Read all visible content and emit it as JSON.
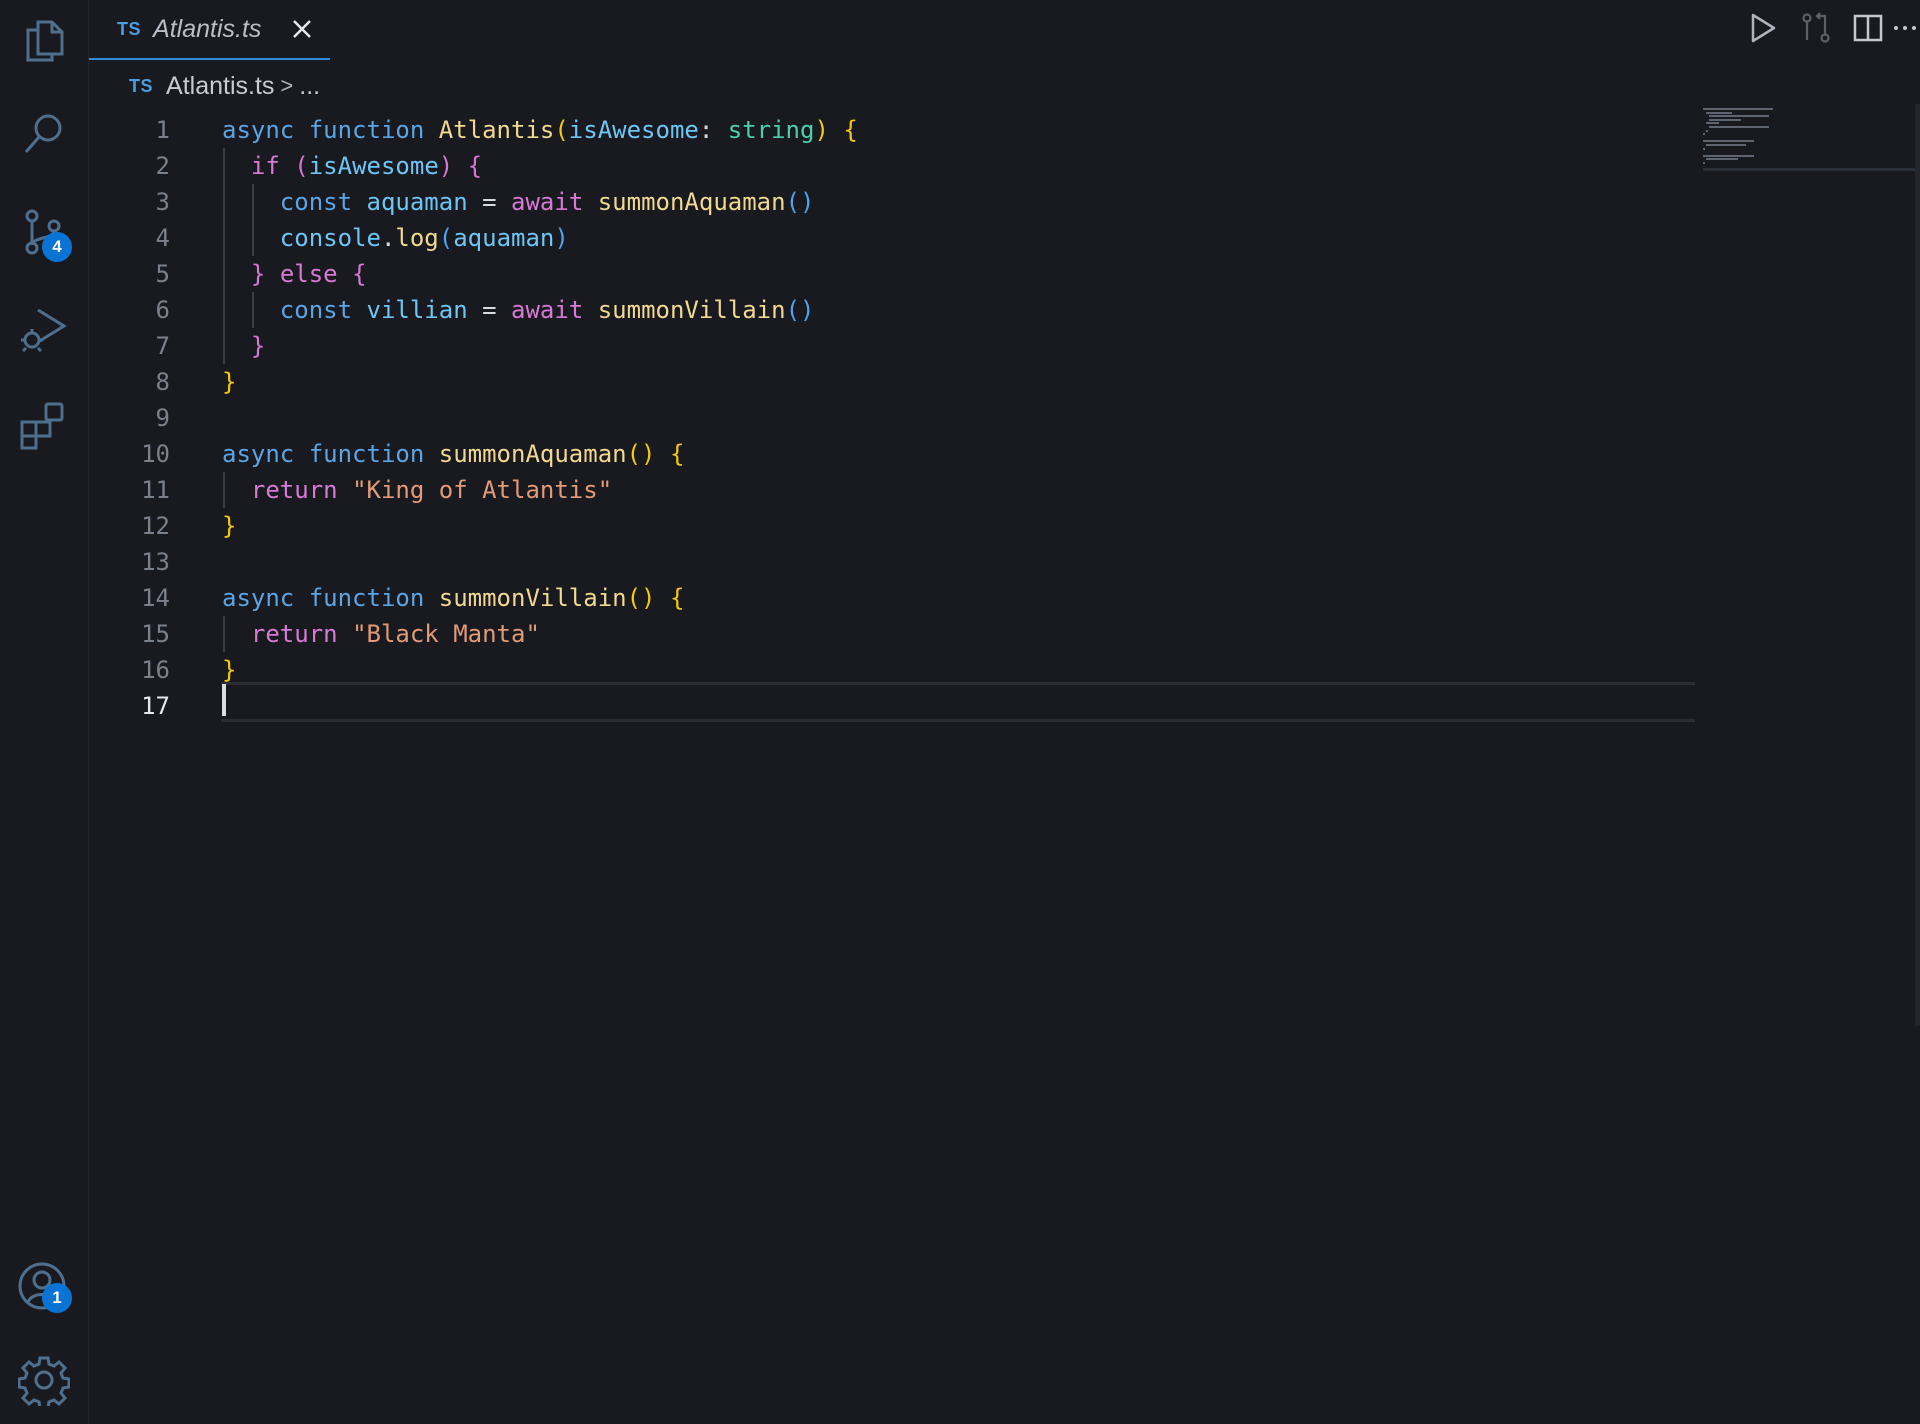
{
  "tab": {
    "lang_badge": "TS",
    "filename": "Atlantis.ts"
  },
  "breadcrumb": {
    "lang_badge": "TS",
    "file": "Atlantis.ts",
    "separator": ">",
    "ellipsis": "..."
  },
  "activity_bar": {
    "items": [
      "explorer-icon",
      "search-icon",
      "source-control-icon",
      "run-debug-icon",
      "extensions-icon"
    ],
    "source_control_badge": "4",
    "accounts_badge": "1",
    "bottom_items": [
      "accounts-icon",
      "settings-gear-icon"
    ]
  },
  "toolbar": {
    "items": [
      "run-icon",
      "compare-changes-icon",
      "split-editor-icon",
      "more-actions-icon"
    ]
  },
  "editor": {
    "active_line": 17,
    "lines": [
      {
        "n": "1",
        "tokens": [
          [
            "kw",
            "async "
          ],
          [
            "kw",
            "function "
          ],
          [
            "fn",
            "Atlantis"
          ],
          [
            "br1",
            "("
          ],
          [
            "var",
            "isAwesome"
          ],
          [
            "plain",
            ": "
          ],
          [
            "type",
            "string"
          ],
          [
            "br1",
            ")"
          ],
          [
            "plain",
            " "
          ],
          [
            "br1",
            "{"
          ]
        ]
      },
      {
        "n": "2",
        "tokens": [
          [
            "plain",
            "  "
          ],
          [
            "ctl",
            "if "
          ],
          [
            "br2",
            "("
          ],
          [
            "var",
            "isAwesome"
          ],
          [
            "br2",
            ")"
          ],
          [
            "plain",
            " "
          ],
          [
            "br2",
            "{"
          ]
        ]
      },
      {
        "n": "3",
        "tokens": [
          [
            "plain",
            "    "
          ],
          [
            "kw",
            "const "
          ],
          [
            "var",
            "aquaman"
          ],
          [
            "plain",
            " = "
          ],
          [
            "ctl",
            "await "
          ],
          [
            "fn",
            "summonAquaman"
          ],
          [
            "br3",
            "()"
          ]
        ]
      },
      {
        "n": "4",
        "tokens": [
          [
            "plain",
            "    "
          ],
          [
            "var",
            "console"
          ],
          [
            "plain",
            "."
          ],
          [
            "fn",
            "log"
          ],
          [
            "br3",
            "("
          ],
          [
            "var",
            "aquaman"
          ],
          [
            "br3",
            ")"
          ]
        ]
      },
      {
        "n": "5",
        "tokens": [
          [
            "plain",
            "  "
          ],
          [
            "br2",
            "}"
          ],
          [
            "plain",
            " "
          ],
          [
            "ctl",
            "else "
          ],
          [
            "br2",
            "{"
          ]
        ]
      },
      {
        "n": "6",
        "tokens": [
          [
            "plain",
            "    "
          ],
          [
            "kw",
            "const "
          ],
          [
            "var",
            "villian"
          ],
          [
            "plain",
            " = "
          ],
          [
            "ctl",
            "await "
          ],
          [
            "fn",
            "summonVillain"
          ],
          [
            "br3",
            "()"
          ]
        ]
      },
      {
        "n": "7",
        "tokens": [
          [
            "plain",
            "  "
          ],
          [
            "br2",
            "}"
          ]
        ]
      },
      {
        "n": "8",
        "tokens": [
          [
            "br1",
            "}"
          ]
        ]
      },
      {
        "n": "9",
        "tokens": []
      },
      {
        "n": "10",
        "tokens": [
          [
            "kw",
            "async "
          ],
          [
            "kw",
            "function "
          ],
          [
            "fn",
            "summonAquaman"
          ],
          [
            "br1",
            "()"
          ],
          [
            "plain",
            " "
          ],
          [
            "br1",
            "{"
          ]
        ]
      },
      {
        "n": "11",
        "tokens": [
          [
            "plain",
            "  "
          ],
          [
            "ctl",
            "return "
          ],
          [
            "str",
            "\"King of Atlantis\""
          ]
        ]
      },
      {
        "n": "12",
        "tokens": [
          [
            "br1",
            "}"
          ]
        ]
      },
      {
        "n": "13",
        "tokens": []
      },
      {
        "n": "14",
        "tokens": [
          [
            "kw",
            "async "
          ],
          [
            "kw",
            "function "
          ],
          [
            "fn",
            "summonVillain"
          ],
          [
            "br1",
            "()"
          ],
          [
            "plain",
            " "
          ],
          [
            "br1",
            "{"
          ]
        ]
      },
      {
        "n": "15",
        "tokens": [
          [
            "plain",
            "  "
          ],
          [
            "ctl",
            "return "
          ],
          [
            "str",
            "\"Black Manta\""
          ]
        ]
      },
      {
        "n": "16",
        "tokens": [
          [
            "br1",
            "}"
          ]
        ]
      },
      {
        "n": "17",
        "tokens": []
      }
    ]
  },
  "colors": {
    "background": "#181a1f",
    "accent": "#2d8be0",
    "badge": "#0a74d4"
  }
}
